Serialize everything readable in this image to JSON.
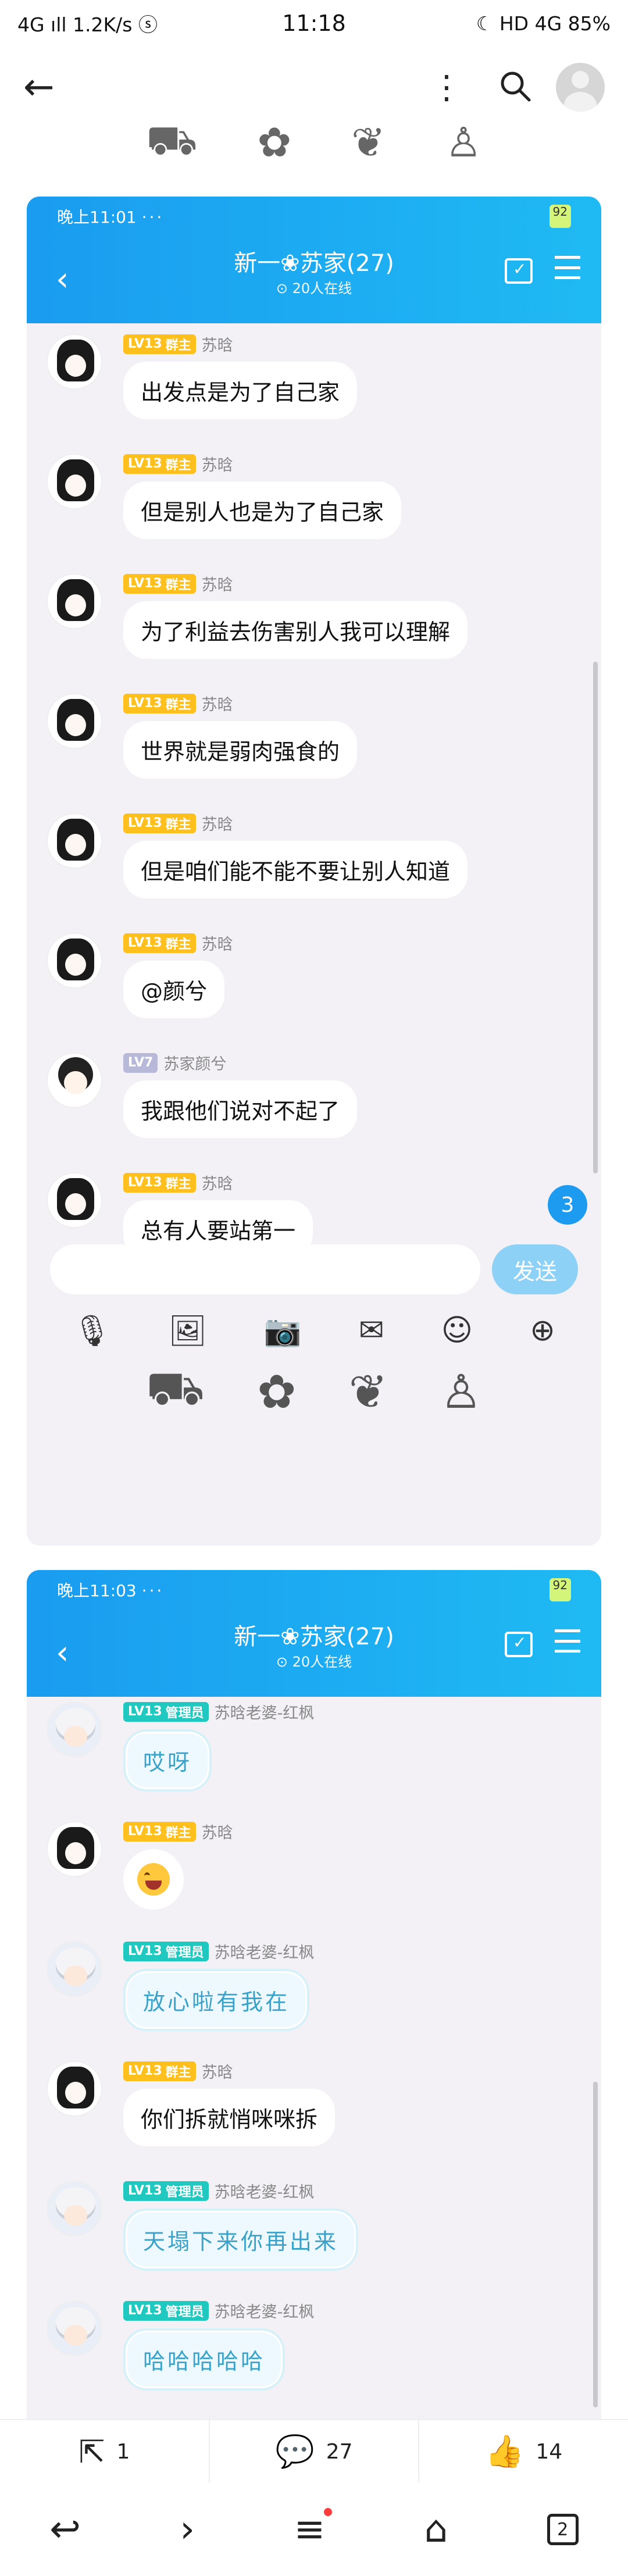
{
  "status_bar": {
    "left": "4G ıll 1.2K/s ⓢ",
    "time": "11:18",
    "right": "☾ HD 4G 85%"
  },
  "screens": [
    {
      "status_time": "晚上11:01",
      "status_dots": "···",
      "battery": "92",
      "title": "新一❀苏家(27)",
      "subtitle": "⊙ 20人在线",
      "messages": [
        {
          "level": "LV13",
          "role": "群主",
          "name": "苏晗",
          "text": "出发点是为了自己家"
        },
        {
          "level": "LV13",
          "role": "群主",
          "name": "苏晗",
          "text": "但是别人也是为了自己家"
        },
        {
          "level": "LV13",
          "role": "群主",
          "name": "苏晗",
          "text": "为了利益去伤害别人我可以理解"
        },
        {
          "level": "LV13",
          "role": "群主",
          "name": "苏晗",
          "text": "世界就是弱肉强食的"
        },
        {
          "level": "LV13",
          "role": "群主",
          "name": "苏晗",
          "text": "但是咱们能不能不要让别人知道"
        },
        {
          "level": "LV13",
          "role": "群主",
          "name": "苏晗",
          "text": "@颜兮"
        },
        {
          "level": "LV7",
          "role": "",
          "name": "苏家颜兮",
          "text": "我跟他们说对不起了"
        },
        {
          "level": "LV13",
          "role": "群主",
          "name": "苏晗",
          "text": "总有人要站第一"
        }
      ],
      "unread": "3",
      "send_label": "发送"
    },
    {
      "status_time": "晚上11:03",
      "status_dots": "···",
      "battery": "92",
      "title": "新一❀苏家(27)",
      "subtitle": "⊙ 20人在线",
      "messages": [
        {
          "level": "LV13",
          "role": "管理员",
          "name": "苏晗老婆-红枫",
          "text": "哎呀"
        },
        {
          "level": "LV13",
          "role": "群主",
          "name": "苏晗",
          "text": ""
        },
        {
          "level": "LV13",
          "role": "管理员",
          "name": "苏晗老婆-红枫",
          "text": "放心啦有我在"
        },
        {
          "level": "LV13",
          "role": "群主",
          "name": "苏晗",
          "text": "你们拆就悄咪咪拆"
        },
        {
          "level": "LV13",
          "role": "管理员",
          "name": "苏晗老婆-红枫",
          "text": "天塌下来你再出来"
        },
        {
          "level": "LV13",
          "role": "管理员",
          "name": "苏晗老婆-红枫",
          "text": "哈哈哈哈哈"
        }
      ]
    }
  ],
  "bottom_bar": {
    "share_count": "1",
    "comment_count": "27",
    "like_count": "14"
  },
  "nav": {
    "tabs_count": "2"
  }
}
